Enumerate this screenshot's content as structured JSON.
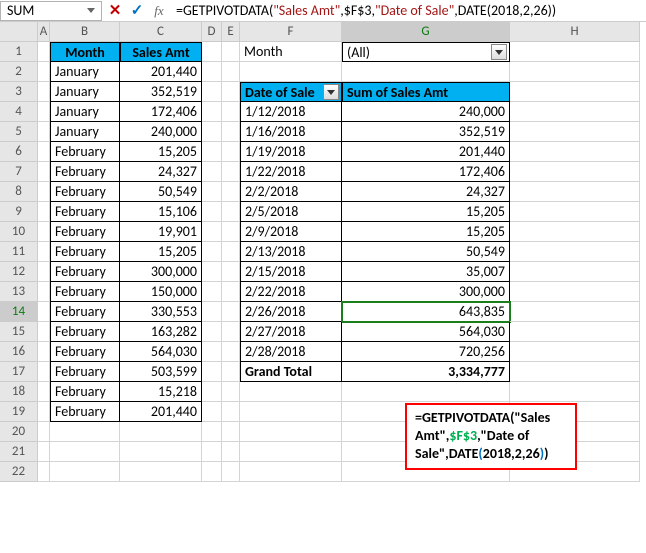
{
  "namebox": "SUM",
  "formula_bar": {
    "prefix": "=GETPIVOTDATA(",
    "arg1": "\"Sales Amt\"",
    "arg2": "$F$3",
    "arg3": "\"Date of Sale\"",
    "arg4": "DATE(2018,2,26)",
    "suffix": ")"
  },
  "cols": [
    "A",
    "B",
    "C",
    "D",
    "E",
    "F",
    "G",
    "H"
  ],
  "table1": {
    "headers": {
      "b": "Month",
      "c": "Sales Amt"
    },
    "rows": [
      {
        "b": "January",
        "c": "201,440"
      },
      {
        "b": "January",
        "c": "352,519"
      },
      {
        "b": "January",
        "c": "172,406"
      },
      {
        "b": "January",
        "c": "240,000"
      },
      {
        "b": "February",
        "c": "15,205"
      },
      {
        "b": "February",
        "c": "24,327"
      },
      {
        "b": "February",
        "c": "50,549"
      },
      {
        "b": "February",
        "c": "15,106"
      },
      {
        "b": "February",
        "c": "19,901"
      },
      {
        "b": "February",
        "c": "15,205"
      },
      {
        "b": "February",
        "c": "300,000"
      },
      {
        "b": "February",
        "c": "150,000"
      },
      {
        "b": "February",
        "c": "330,553"
      },
      {
        "b": "February",
        "c": "163,282"
      },
      {
        "b": "February",
        "c": "564,030"
      },
      {
        "b": "February",
        "c": "503,599"
      },
      {
        "b": "February",
        "c": "15,218"
      },
      {
        "b": "February",
        "c": "201,440"
      }
    ]
  },
  "filter": {
    "label": "Month",
    "value": "(All)"
  },
  "pivot": {
    "headers": {
      "f": "Date of Sale",
      "g": "Sum of Sales Amt"
    },
    "rows": [
      {
        "f": "1/12/2018",
        "g": "240,000"
      },
      {
        "f": "1/16/2018",
        "g": "352,519"
      },
      {
        "f": "1/19/2018",
        "g": "201,440"
      },
      {
        "f": "1/22/2018",
        "g": "172,406"
      },
      {
        "f": "2/2/2018",
        "g": "24,327"
      },
      {
        "f": "2/5/2018",
        "g": "15,205"
      },
      {
        "f": "2/9/2018",
        "g": "15,205"
      },
      {
        "f": "2/13/2018",
        "g": "50,549"
      },
      {
        "f": "2/15/2018",
        "g": "35,007"
      },
      {
        "f": "2/22/2018",
        "g": "300,000"
      },
      {
        "f": "2/26/2018",
        "g": "643,835"
      },
      {
        "f": "2/27/2018",
        "g": "564,030"
      },
      {
        "f": "2/28/2018",
        "g": "720,256"
      }
    ],
    "total": {
      "f": "Grand Total",
      "g": "3,334,777"
    }
  },
  "overlay": {
    "line1a": "=GETPIVOTDATA(",
    "line1b": "\"Sales",
    "line2a": "Amt\",",
    "line2b": "$F$3",
    "line2c": ",\"Date of",
    "line3a": "Sale\",",
    "line3b": "DATE",
    "line3c": "(",
    "line3d": "2018,2,26",
    "line3e": ")",
    "line3f": ")"
  },
  "chart_data": {
    "type": "table",
    "tables": [
      {
        "name": "source",
        "columns": [
          "Month",
          "Sales Amt"
        ],
        "rows": [
          [
            "January",
            201440
          ],
          [
            "January",
            352519
          ],
          [
            "January",
            172406
          ],
          [
            "January",
            240000
          ],
          [
            "February",
            15205
          ],
          [
            "February",
            24327
          ],
          [
            "February",
            50549
          ],
          [
            "February",
            15106
          ],
          [
            "February",
            19901
          ],
          [
            "February",
            15205
          ],
          [
            "February",
            300000
          ],
          [
            "February",
            150000
          ],
          [
            "February",
            330553
          ],
          [
            "February",
            163282
          ],
          [
            "February",
            564030
          ],
          [
            "February",
            503599
          ],
          [
            "February",
            15218
          ],
          [
            "February",
            201440
          ]
        ]
      },
      {
        "name": "pivot",
        "columns": [
          "Date of Sale",
          "Sum of Sales Amt"
        ],
        "rows": [
          [
            "1/12/2018",
            240000
          ],
          [
            "1/16/2018",
            352519
          ],
          [
            "1/19/2018",
            201440
          ],
          [
            "1/22/2018",
            172406
          ],
          [
            "2/2/2018",
            24327
          ],
          [
            "2/5/2018",
            15205
          ],
          [
            "2/9/2018",
            15205
          ],
          [
            "2/13/2018",
            50549
          ],
          [
            "2/15/2018",
            35007
          ],
          [
            "2/22/2018",
            300000
          ],
          [
            "2/26/2018",
            643835
          ],
          [
            "2/27/2018",
            564030
          ],
          [
            "2/28/2018",
            720256
          ]
        ],
        "total": [
          "Grand Total",
          3334777
        ]
      }
    ]
  }
}
